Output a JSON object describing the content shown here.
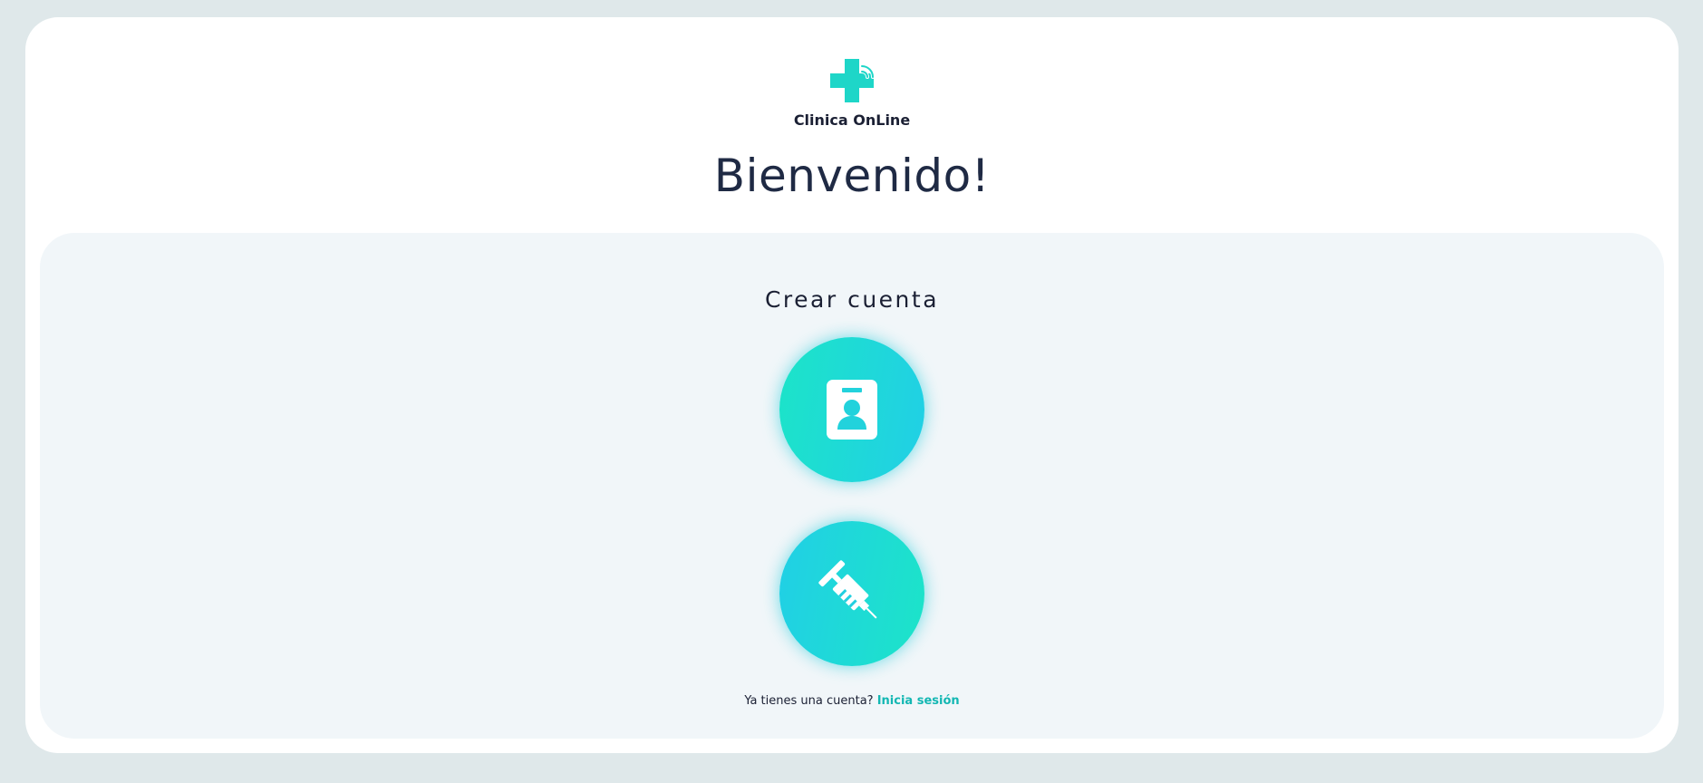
{
  "brand": {
    "name": "Clinica OnLine",
    "logo_icon": "medical-cross-wifi-icon",
    "accent_color": "#1ed6c8"
  },
  "header": {
    "welcome": "Bienvenido!"
  },
  "register": {
    "title": "Crear cuenta",
    "options": [
      {
        "icon": "patient-id-badge-icon"
      },
      {
        "icon": "syringe-icon"
      }
    ]
  },
  "footer": {
    "question": "Ya tienes una cuenta?",
    "login_link": "Inicia sesión"
  }
}
